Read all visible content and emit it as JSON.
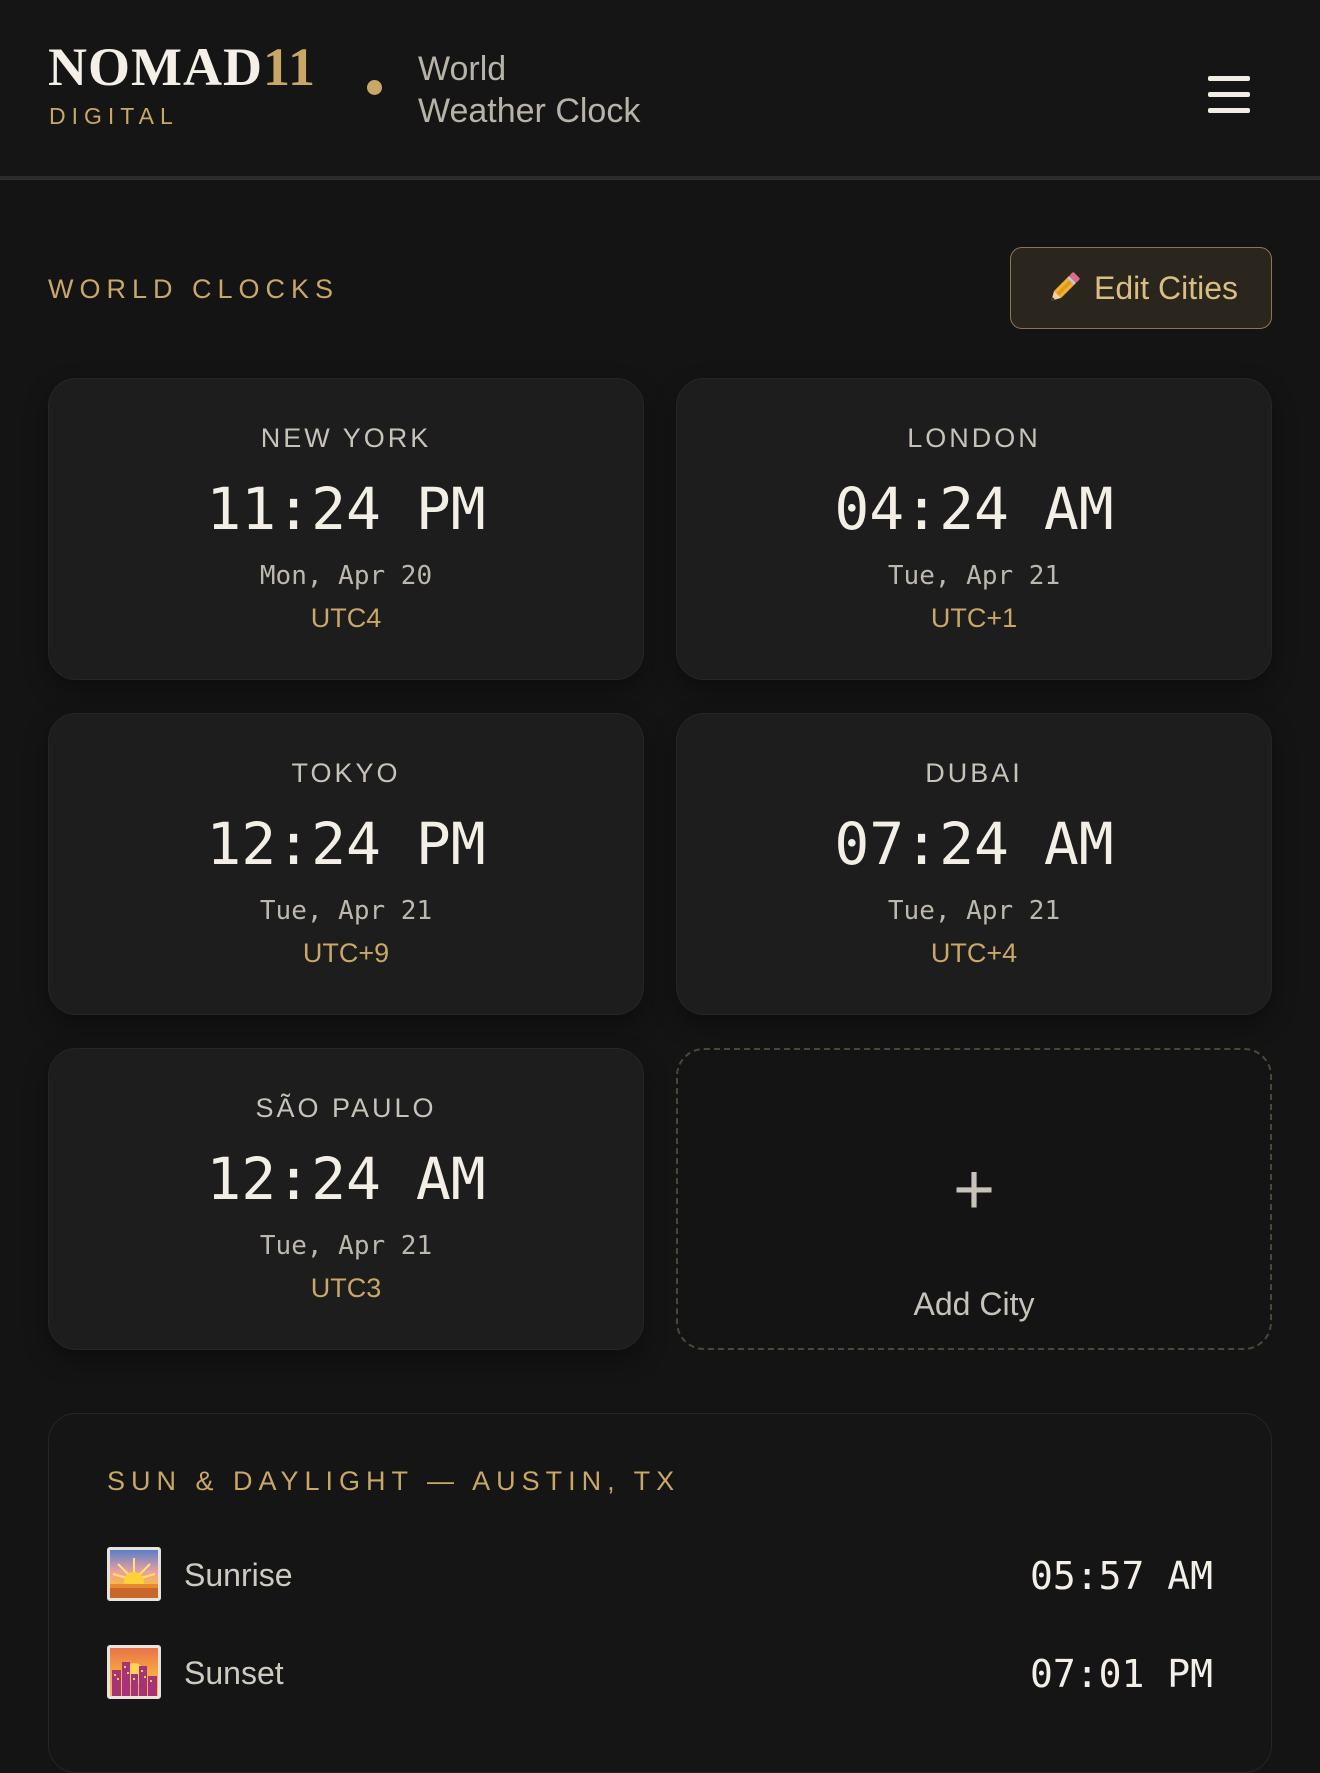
{
  "header": {
    "brand_main": "NOMAD",
    "brand_accent": "11",
    "brand_sub": "DIGITAL",
    "title_line1": "World",
    "title_line2": "Weather Clock",
    "menu_icon": "hamburger-menu-icon"
  },
  "clocks_section": {
    "label": "WORLD CLOCKS",
    "edit_button_icon": "pencil-icon",
    "edit_button_label": "Edit Cities",
    "cities": [
      {
        "name": "NEW YORK",
        "time": "11:24 PM",
        "date": "Mon, Apr 20",
        "tz": "UTC4"
      },
      {
        "name": "LONDON",
        "time": "04:24 AM",
        "date": "Tue, Apr 21",
        "tz": "UTC+1"
      },
      {
        "name": "TOKYO",
        "time": "12:24 PM",
        "date": "Tue, Apr 21",
        "tz": "UTC+9"
      },
      {
        "name": "DUBAI",
        "time": "07:24 AM",
        "date": "Tue, Apr 21",
        "tz": "UTC+4"
      },
      {
        "name": "SÃO PAULO",
        "time": "12:24 AM",
        "date": "Tue, Apr 21",
        "tz": "UTC3"
      }
    ],
    "add_city_icon": "plus-icon",
    "add_city_symbol": "+",
    "add_city_label": "Add City"
  },
  "sun_section": {
    "title": "SUN & DAYLIGHT — AUSTIN, TX",
    "rows": [
      {
        "label": "Sunrise",
        "time": "05:57 AM",
        "icon": "sunrise-icon"
      },
      {
        "label": "Sunset",
        "time": "07:01 PM",
        "icon": "sunset-icon"
      }
    ]
  },
  "colors": {
    "background": "#141414",
    "card": "#1d1d1d",
    "accent_gold": "#c9a766",
    "text_primary": "#f3efe7"
  }
}
